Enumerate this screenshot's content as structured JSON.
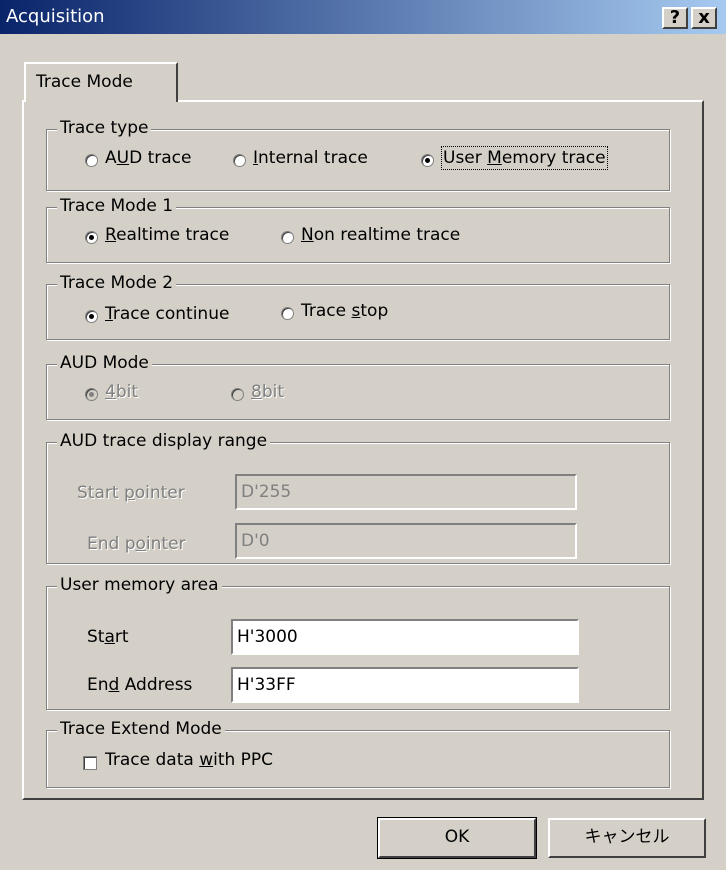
{
  "window": {
    "title": "Acquisition",
    "help_label": "?",
    "close_label": "x"
  },
  "tab": {
    "label": "Trace Mode"
  },
  "trace_type": {
    "legend": "Trace type",
    "options": [
      {
        "pre": "A",
        "ul": "U",
        "post": "D trace",
        "selected": false
      },
      {
        "pre": "",
        "ul": "I",
        "post": "nternal trace",
        "selected": false
      },
      {
        "pre": "User ",
        "ul": "M",
        "post": "emory trace",
        "selected": true
      }
    ]
  },
  "trace_mode1": {
    "legend": "Trace Mode 1",
    "options": [
      {
        "pre": "",
        "ul": "R",
        "post": "ealtime trace",
        "selected": true
      },
      {
        "pre": "",
        "ul": "N",
        "post": "on realtime trace",
        "selected": false
      }
    ]
  },
  "trace_mode2": {
    "legend": "Trace Mode 2",
    "options": [
      {
        "pre": "",
        "ul": "T",
        "post": "race continue",
        "selected": true
      },
      {
        "pre": "Trace ",
        "ul": "s",
        "post": "top",
        "selected": false
      }
    ]
  },
  "aud_mode": {
    "legend": "AUD Mode",
    "options": [
      {
        "pre": "",
        "ul": "4",
        "post": "bit",
        "selected": true
      },
      {
        "pre": "",
        "ul": "8",
        "post": "bit",
        "selected": false
      }
    ]
  },
  "aud_range": {
    "legend": "AUD trace display range",
    "start": {
      "pre": "Start ",
      "ul": "p",
      "post": "ointer",
      "value": "D'255"
    },
    "end": {
      "pre": "End p",
      "ul": "o",
      "post": "inter",
      "value": "D'0"
    }
  },
  "user_memory": {
    "legend": "User memory area",
    "start": {
      "pre": "St",
      "ul": "a",
      "post": "rt",
      "value": "H'3000"
    },
    "end": {
      "pre": "En",
      "ul": "d",
      "post": " Address",
      "value": "H'33FF"
    }
  },
  "extend": {
    "legend": "Trace Extend Mode",
    "checkbox": {
      "pre": "Trace data ",
      "ul": "w",
      "post": "ith PPC",
      "checked": false
    }
  },
  "buttons": {
    "ok": "OK",
    "cancel": "キャンセル"
  }
}
